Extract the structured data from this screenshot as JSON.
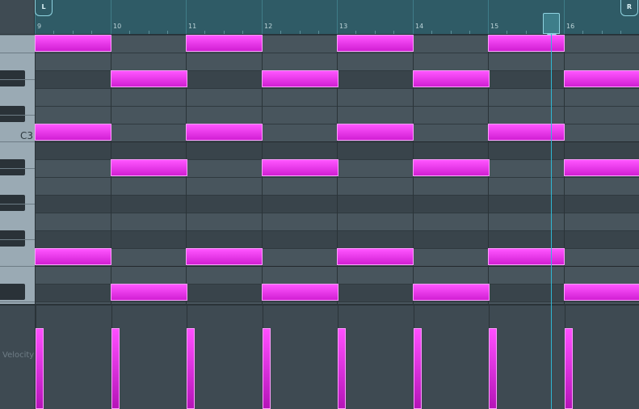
{
  "ruler": {
    "bars": [
      "9",
      "10",
      "11",
      "12",
      "13",
      "14",
      "15",
      "16"
    ],
    "loop_start_label": "L",
    "loop_end_label": "R"
  },
  "keyboard": {
    "c3_label": "C3"
  },
  "velocity": {
    "label": "Velocity"
  },
  "colors": {
    "note": "#e030e4",
    "playhead": "#2fb7d3",
    "ruler": "#2f5b66"
  },
  "notes": [
    {
      "bar": 9,
      "row": 0
    },
    {
      "bar": 11,
      "row": 0
    },
    {
      "bar": 13,
      "row": 0
    },
    {
      "bar": 15,
      "row": 0
    },
    {
      "bar": 10,
      "row": 2
    },
    {
      "bar": 12,
      "row": 2
    },
    {
      "bar": 14,
      "row": 2
    },
    {
      "bar": 16,
      "row": 2
    },
    {
      "bar": 9,
      "row": 5
    },
    {
      "bar": 11,
      "row": 5
    },
    {
      "bar": 13,
      "row": 5
    },
    {
      "bar": 15,
      "row": 5
    },
    {
      "bar": 10,
      "row": 7
    },
    {
      "bar": 12,
      "row": 7
    },
    {
      "bar": 14,
      "row": 7
    },
    {
      "bar": 16,
      "row": 7
    },
    {
      "bar": 9,
      "row": 12
    },
    {
      "bar": 11,
      "row": 12
    },
    {
      "bar": 13,
      "row": 12
    },
    {
      "bar": 15,
      "row": 12
    },
    {
      "bar": 10,
      "row": 14
    },
    {
      "bar": 12,
      "row": 14
    },
    {
      "bar": 14,
      "row": 14
    },
    {
      "bar": 16,
      "row": 14
    }
  ],
  "note_velocities": [
    0.78,
    0.78,
    0.78,
    0.78,
    0.78,
    0.78,
    0.78,
    0.78
  ],
  "playhead_bar": 16
}
